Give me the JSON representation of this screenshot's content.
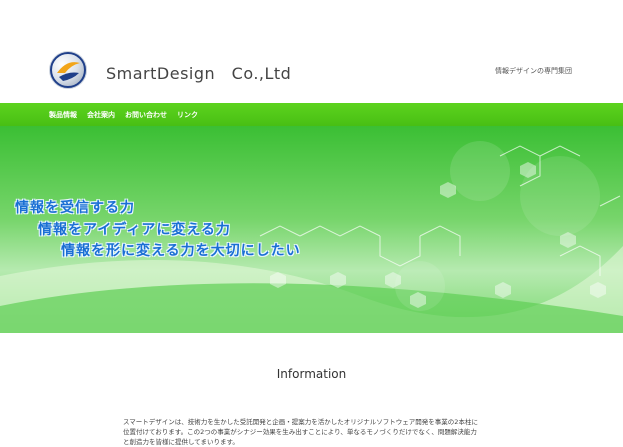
{
  "header": {
    "company_name": "SmartDesign　Co.,Ltd",
    "tagline": "情報デザインの専門集団"
  },
  "nav": {
    "items": [
      "製品情報",
      "会社案内",
      "お問い合わせ",
      "リンク"
    ]
  },
  "hero": {
    "line1": "情報を受信する力",
    "line2": "情報をアイディアに変える力",
    "line3": "情報を形に変える力を大切にしたい"
  },
  "section": {
    "title": "Information",
    "body": "スマートデザインは、技術力を生かした受託開発と企画・提案力を活かしたオリジナルソフトウェア開発を事業の2本柱に位置付けております。この2つの事業がシナジー効果を生み出すことにより、単なるモノづくりだけでなく、問題解決能力と創造力を皆様に提供してまいります。"
  },
  "colors": {
    "nav_green": "#4fc91a",
    "hero_text_blue": "#1a6fd4"
  },
  "icons": [
    "company-logo-icon"
  ]
}
